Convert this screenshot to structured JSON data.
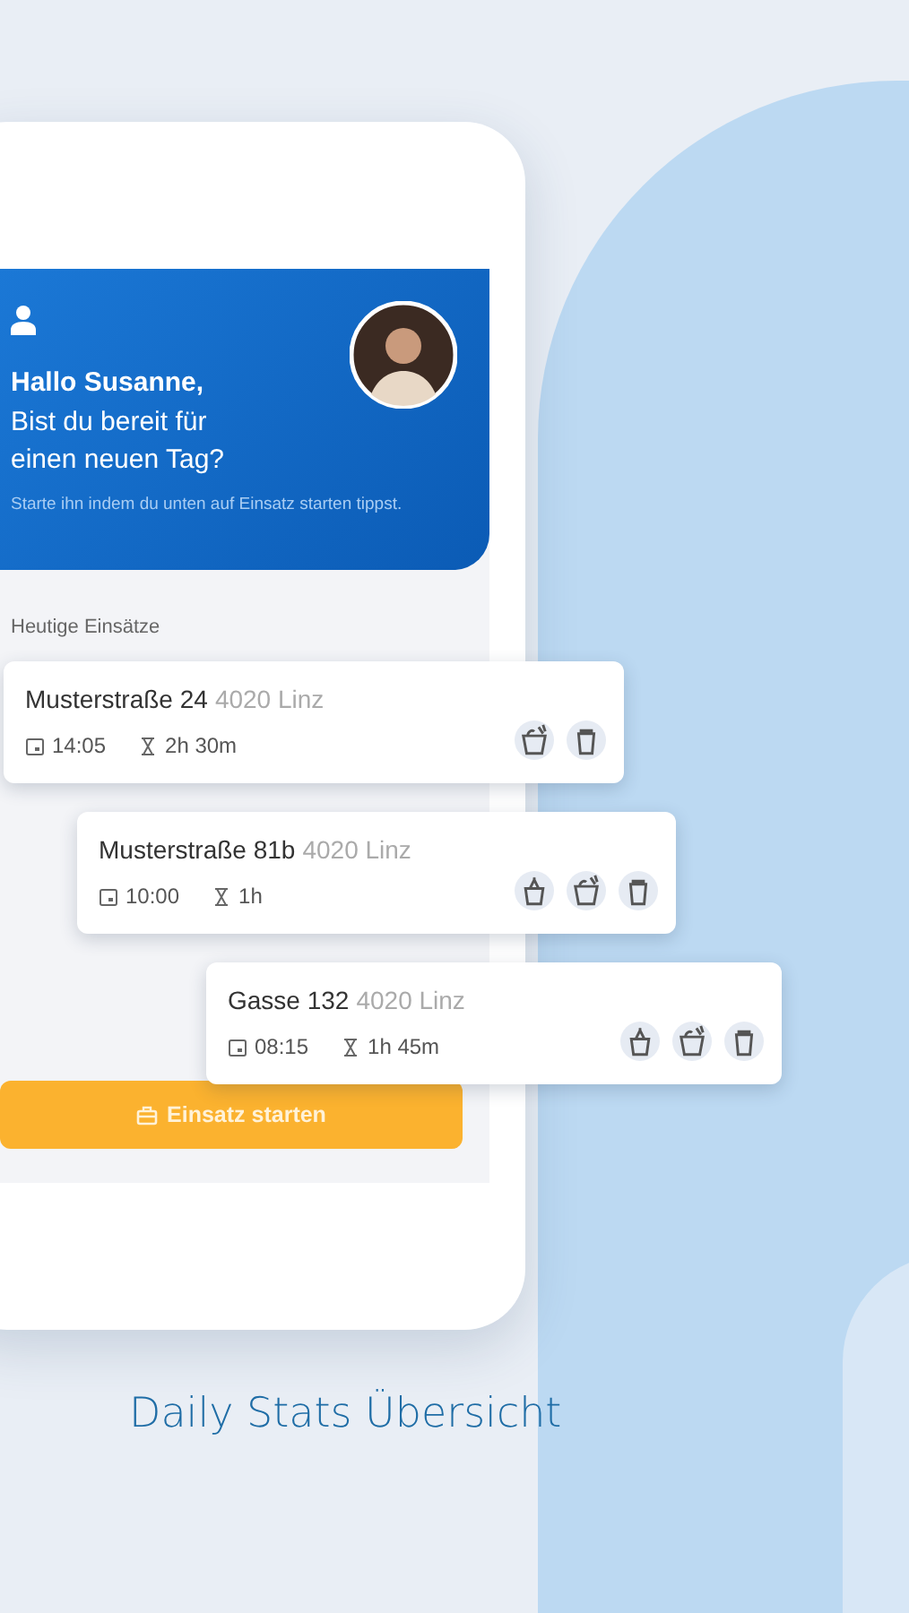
{
  "header": {
    "greeting": "Hallo Susanne,",
    "question": "Bist du bereit für einen neuen Tag?",
    "hint": "Starte ihn indem du unten auf Einsatz starten tippst."
  },
  "section_title": "Heutige Einsätze",
  "jobs": [
    {
      "street": "Musterstraße 24",
      "city": "4020 Linz",
      "time": "14:05",
      "duration": "2h 30m",
      "services": [
        {
          "kind": "bucket"
        },
        {
          "kind": "bin"
        }
      ]
    },
    {
      "street": "Musterstraße 81b",
      "city": "4020 Linz",
      "time": "10:00",
      "duration": "1h",
      "services": [
        {
          "kind": "basket"
        },
        {
          "kind": "bucket"
        },
        {
          "kind": "bin"
        }
      ]
    },
    {
      "street": "Gasse 132",
      "city": "4020 Linz",
      "time": "08:15",
      "duration": "1h 45m",
      "services": [
        {
          "kind": "basket"
        },
        {
          "kind": "bucket"
        },
        {
          "kind": "bin"
        }
      ]
    }
  ],
  "start_button": {
    "label": "Einsatz starten"
  },
  "caption": "Daily Stats Übersicht"
}
